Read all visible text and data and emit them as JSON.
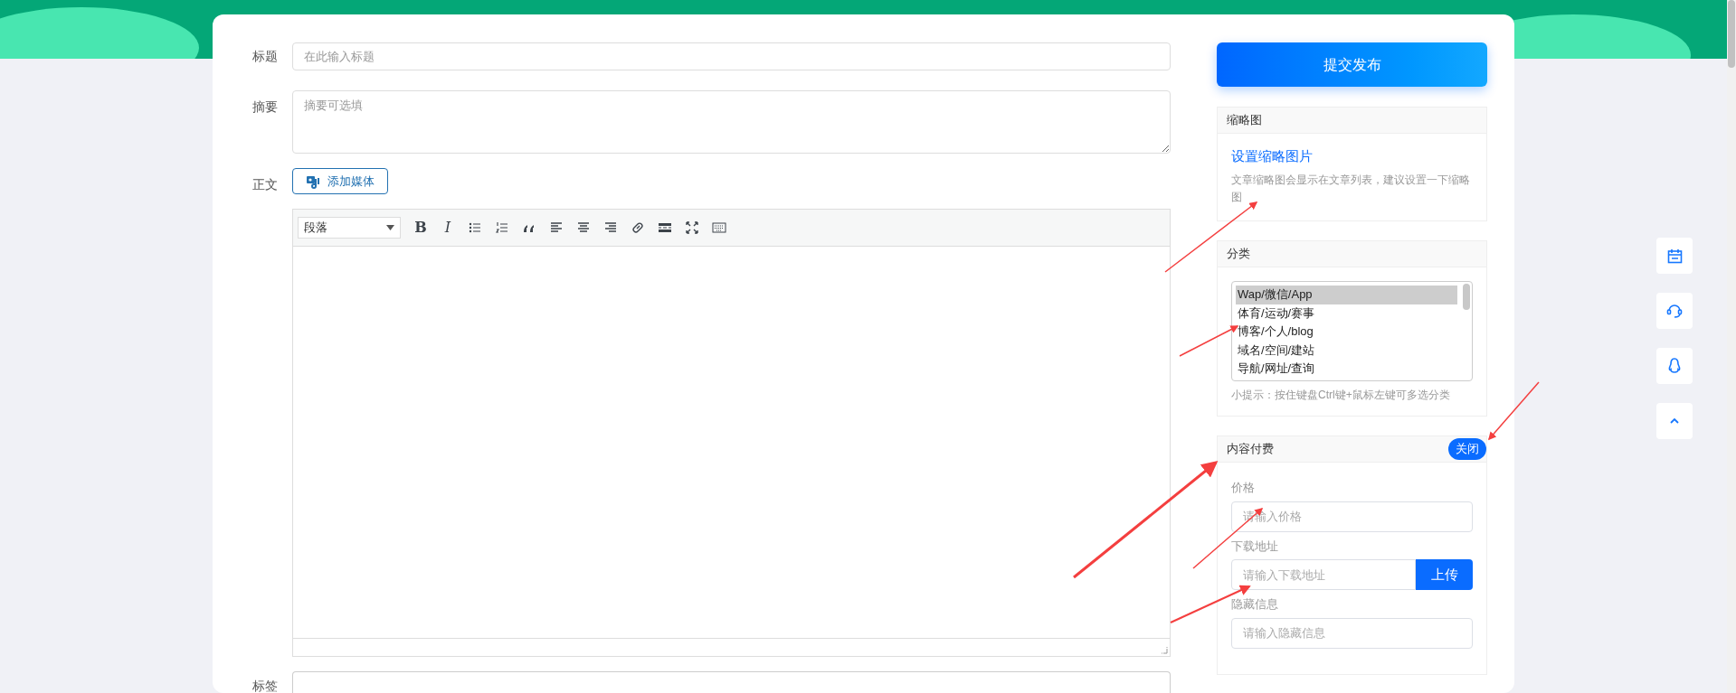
{
  "form": {
    "title": {
      "label": "标题",
      "placeholder": "在此输入标题"
    },
    "summary": {
      "label": "摘要",
      "placeholder": "摘要可选填"
    },
    "body": {
      "label": "正文",
      "add_media": "添加媒体",
      "format": "段落",
      "toolbar_text": [
        {
          "label": "B",
          "kind": "bold"
        },
        {
          "label": "I",
          "kind": "italic"
        }
      ]
    },
    "tags": {
      "label": "标签"
    }
  },
  "sidebar": {
    "submit": "提交发布",
    "thumbnail": {
      "title": "缩略图",
      "link": "设置缩略图片",
      "hint": "文章缩略图会显示在文章列表，建议设置一下缩略图"
    },
    "category": {
      "title": "分类",
      "items": [
        {
          "label": "Wap/微信/App",
          "selected": true
        },
        {
          "label": "体育/运动/赛事",
          "selected": false
        },
        {
          "label": "博客/个人/blog",
          "selected": false
        },
        {
          "label": "域名/空间/建站",
          "selected": false
        },
        {
          "label": "导航/网址/查询",
          "selected": false
        }
      ],
      "hint": "小提示：按住键盘Ctrl键+鼠标左键可多选分类"
    },
    "paid": {
      "title": "内容付费",
      "toggle": "关闭",
      "fields": [
        {
          "label": "价格",
          "placeholder": "请输入价格",
          "kind": "plain"
        },
        {
          "label": "下载地址",
          "placeholder": "请输入下载地址",
          "kind": "upload",
          "button": "上传"
        },
        {
          "label": "隐藏信息",
          "placeholder": "请输入隐藏信息",
          "kind": "plain"
        }
      ]
    }
  }
}
